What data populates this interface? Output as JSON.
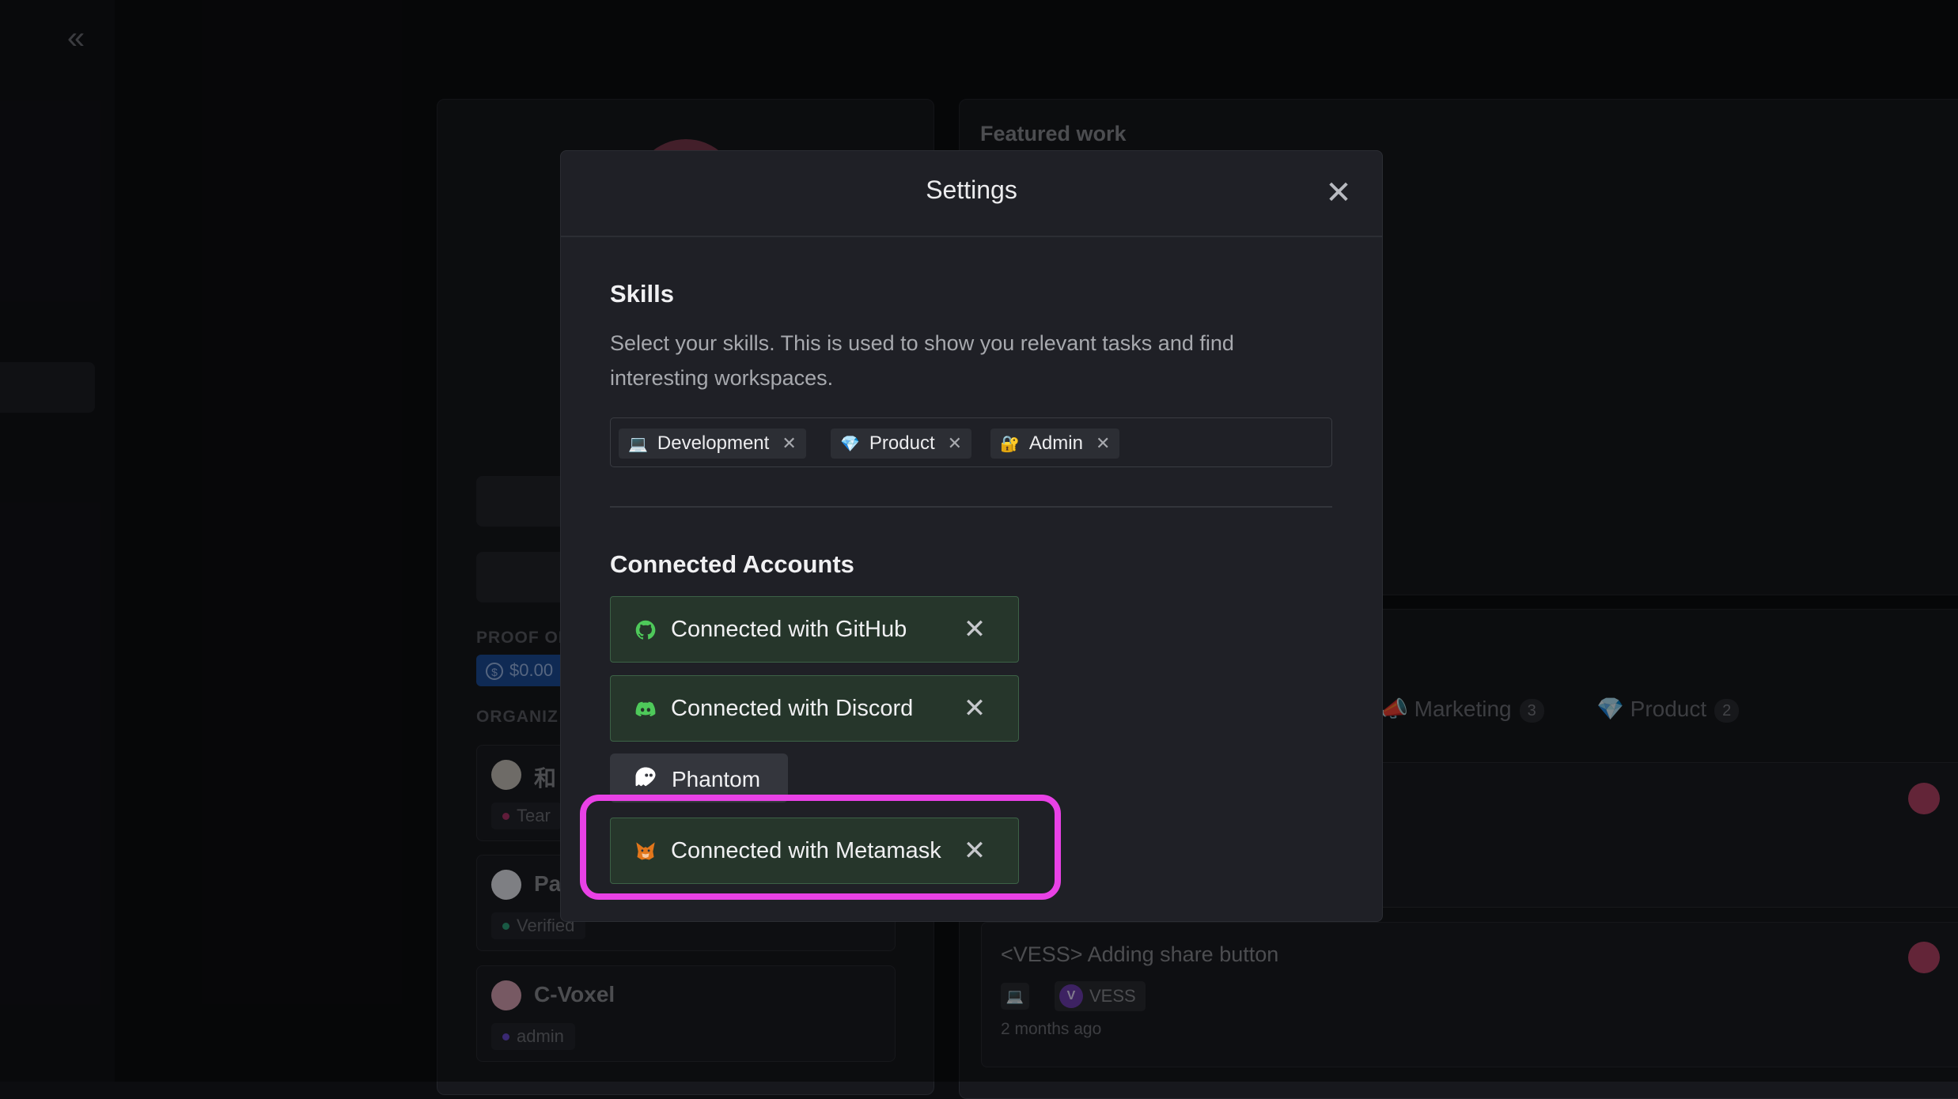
{
  "background": {
    "sidebar": {
      "collapse_icon": "double-chevron-left-icon",
      "collapse_glyph": "«"
    },
    "profile": {
      "proof_label": "PROOF OF",
      "proof_value": "$0.00",
      "orgs_label": "ORGANIZ",
      "orgs": [
        {
          "name": "和",
          "tag": "Tear",
          "tag_color": "#b0336a"
        },
        {
          "name": "Pa",
          "tag": "Verified",
          "tag_color": "#2fa37c"
        },
        {
          "name": "C-Voxel",
          "tag": "admin",
          "tag_color": "#6a4bd1"
        }
      ]
    },
    "featured": {
      "title": "Featured work"
    },
    "tasks": {
      "tabs": [
        {
          "emoji": "📣",
          "label": "Marketing",
          "count": "3"
        },
        {
          "emoji": "💎",
          "label": "Product",
          "count": "2"
        }
      ],
      "task2": {
        "title": "<VESS> Adding share button",
        "org": "VESS",
        "org_logo": "V",
        "time": "2 months ago",
        "skill_emoji": "💻"
      }
    }
  },
  "modal": {
    "title": "Settings",
    "close_glyph": "✕",
    "skills": {
      "heading": "Skills",
      "description": "Select your skills. This is used to show you relevant tasks and find interesting workspaces.",
      "chips": [
        {
          "emoji": "💻",
          "label": "Development",
          "remove": "✕"
        },
        {
          "emoji": "💎",
          "label": "Product",
          "remove": "✕"
        },
        {
          "emoji": "🔐",
          "label": "Admin",
          "remove": "✕"
        }
      ]
    },
    "connected_accounts": {
      "heading": "Connected Accounts",
      "accounts": [
        {
          "label": "Connected with GitHub",
          "icon": "github-icon",
          "remove": "✕"
        },
        {
          "label": "Connected with Discord",
          "icon": "discord-icon",
          "remove": "✕"
        },
        {
          "label": "Connected with Metamask",
          "icon": "metamask-fox-icon",
          "remove": "✕"
        }
      ],
      "phantom": {
        "label": "Phantom",
        "icon": "phantom-ghost-icon"
      }
    }
  },
  "colors": {
    "connected_bg": "#26362b",
    "connected_border": "#3c6146",
    "icon_green": "#4ec95a",
    "highlight": "#e941e6"
  }
}
